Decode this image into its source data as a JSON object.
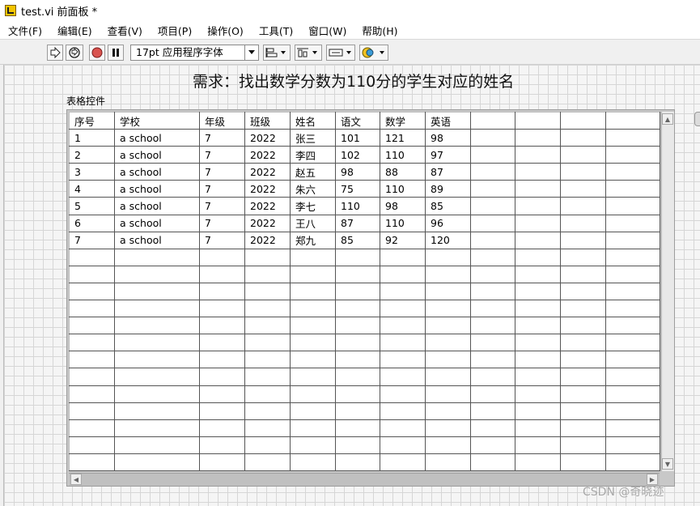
{
  "window": {
    "title": "test.vi 前面板 *"
  },
  "menu": [
    "文件(F)",
    "编辑(E)",
    "查看(V)",
    "项目(P)",
    "操作(O)",
    "工具(T)",
    "窗口(W)",
    "帮助(H)"
  ],
  "toolbar": {
    "font_value": "17pt 应用程序字体"
  },
  "panel": {
    "heading": "需求：找出数学分数为110分的学生对应的姓名",
    "table_label": "表格控件"
  },
  "table": {
    "headers": [
      "序号",
      "学校",
      "年级",
      "班级",
      "姓名",
      "语文",
      "数学",
      "英语",
      "",
      "",
      "",
      ""
    ],
    "rows": [
      [
        "1",
        "a school",
        "7",
        "2022",
        "张三",
        "101",
        "121",
        "98",
        "",
        "",
        "",
        ""
      ],
      [
        "2",
        "a school",
        "7",
        "2022",
        "李四",
        "102",
        "110",
        "97",
        "",
        "",
        "",
        ""
      ],
      [
        "3",
        "a school",
        "7",
        "2022",
        "赵五",
        "98",
        "88",
        "87",
        "",
        "",
        "",
        ""
      ],
      [
        "4",
        "a school",
        "7",
        "2022",
        "朱六",
        "75",
        "110",
        "89",
        "",
        "",
        "",
        ""
      ],
      [
        "5",
        "a school",
        "7",
        "2022",
        "李七",
        "110",
        "98",
        "85",
        "",
        "",
        "",
        ""
      ],
      [
        "6",
        "a school",
        "7",
        "2022",
        "王八",
        "87",
        "110",
        "96",
        "",
        "",
        "",
        ""
      ],
      [
        "7",
        "a school",
        "7",
        "2022",
        "郑九",
        "85",
        "92",
        "120",
        "",
        "",
        "",
        ""
      ]
    ],
    "empty_rows": 13
  },
  "watermark": "CSDN @奇晓迹"
}
